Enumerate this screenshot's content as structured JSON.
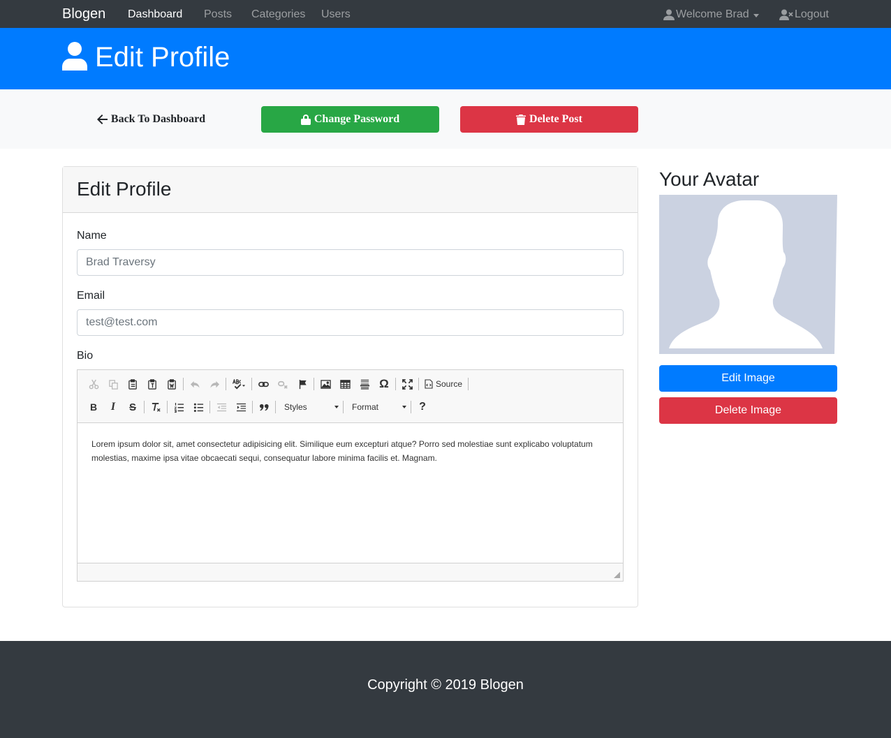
{
  "navbar": {
    "brand": "Blogen",
    "links": [
      "Dashboard",
      "Posts",
      "Categories",
      "Users"
    ],
    "active": "Dashboard",
    "welcome": "Welcome Brad",
    "logout": "Logout"
  },
  "header": {
    "title": "Edit Profile"
  },
  "actions": {
    "back": "Back To Dashboard",
    "change_password": "Change Password",
    "delete_post": "Delete Post"
  },
  "form": {
    "title": "Edit Profile",
    "name_label": "Name",
    "name_value": "Brad Traversy",
    "email_label": "Email",
    "email_value": "test@test.com",
    "bio_label": "Bio",
    "bio_text": "Lorem ipsum dolor sit, amet consectetur adipisicing elit. Similique eum excepturi atque? Porro sed molestiae sunt explicabo voluptatum molestias, maxime ipsa vitae obcaecati sequi, consequatur labore minima facilis et. Magnam."
  },
  "editor": {
    "source_label": "Source",
    "styles_label": "Styles",
    "format_label": "Format",
    "help_label": "?",
    "bold": "B",
    "italic": "I",
    "strike": "S",
    "omega": "Ω"
  },
  "avatar": {
    "title": "Your Avatar",
    "edit_button": "Edit Image",
    "delete_button": "Delete Image"
  },
  "footer": {
    "text": "Copyright © 2019 Blogen"
  },
  "colors": {
    "navbar": "#343a40",
    "primary": "#007bff",
    "success": "#28a745",
    "danger": "#dc3545",
    "light": "#f8f9fa",
    "avatar_bg": "#cbd2e1"
  }
}
